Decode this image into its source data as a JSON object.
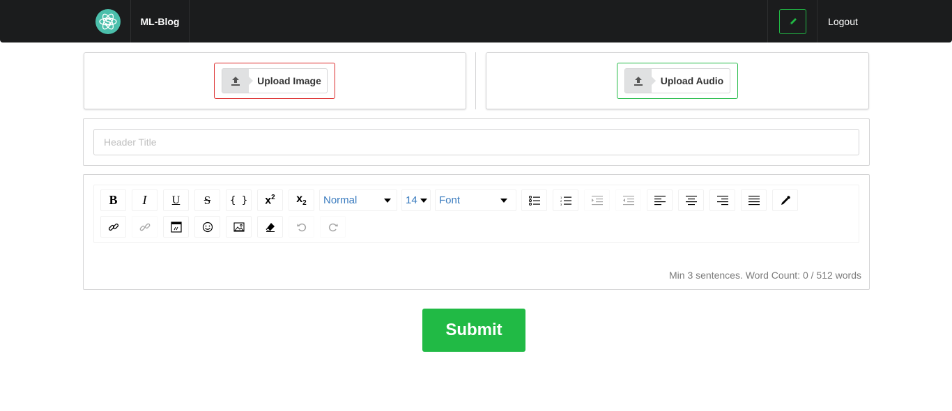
{
  "navbar": {
    "brand": "ML-Blog",
    "logout": "Logout",
    "logo_icon": "atom-logo-icon",
    "edit_icon": "pencil-icon",
    "edit_color": "#21ba45"
  },
  "uploads": {
    "image_label": "Upload Image",
    "image_border_color": "#db2828",
    "audio_label": "Upload Audio",
    "audio_border_color": "#21ba45",
    "icon": "upload-icon"
  },
  "title_field": {
    "placeholder": "Header Title",
    "value": ""
  },
  "editor": {
    "block_type": "Normal",
    "font_size": "14",
    "font_family": "Font",
    "word_count_text": "Min 3 sentences. Word Count: 0 / 512 words"
  },
  "submit": {
    "label": "Submit",
    "color": "#21ba45"
  }
}
